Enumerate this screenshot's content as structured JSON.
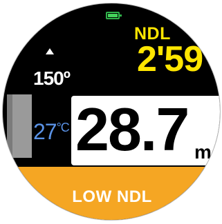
{
  "battery": {
    "icon": "battery-icon",
    "level": 1.0,
    "color": "#45d35c"
  },
  "ndl": {
    "label": "NDL",
    "value": "2'59",
    "color": "#ffe600"
  },
  "heading": {
    "value": "150º",
    "icon": "heading-up-arrow-icon"
  },
  "temperature": {
    "value": "27",
    "unit": "°C",
    "color": "#5a92e6"
  },
  "depth": {
    "value": "28.7",
    "unit": "m"
  },
  "alert": {
    "text": "LOW NDL",
    "color": "#f5a623"
  }
}
